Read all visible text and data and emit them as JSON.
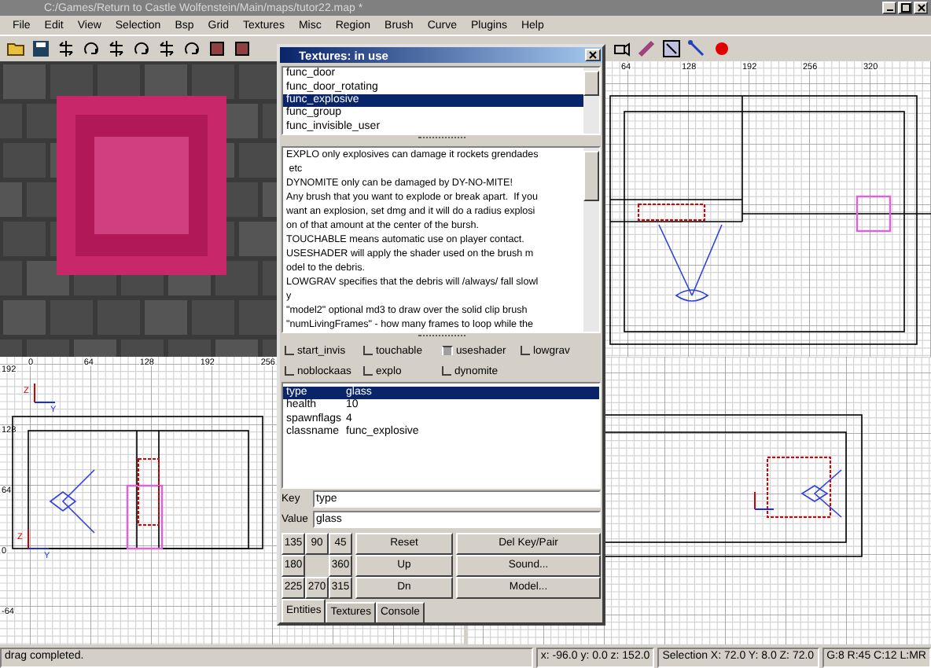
{
  "window": {
    "title": "C:/Games/Return to Castle Wolfenstein/Main/maps/tutor22.map *"
  },
  "menu_bar": [
    "File",
    "Edit",
    "View",
    "Selection",
    "Bsp",
    "Grid",
    "Textures",
    "Misc",
    "Region",
    "Brush",
    "Curve",
    "Plugins",
    "Help"
  ],
  "grid_views": [
    {
      "x_ticks": [
        "0",
        "64",
        "128",
        "192",
        "256"
      ],
      "y_ticks": [
        "192",
        "128",
        "64",
        "0",
        "-64"
      ],
      "axes": [
        {
          "vertical": "Z",
          "horizontal": "Y"
        },
        {
          "vertical": "Z",
          "horizontal": "Y"
        }
      ]
    },
    {
      "x_ticks": [
        "64",
        "128",
        "192",
        "256",
        "320"
      ]
    }
  ],
  "entity_window": {
    "title": "Textures: in use",
    "classes": [
      {
        "name": "func_door",
        "selected": false
      },
      {
        "name": "func_door_rotating",
        "selected": false
      },
      {
        "name": "func_explosive",
        "selected": true
      },
      {
        "name": "func_group",
        "selected": false
      },
      {
        "name": "func_invisible_user",
        "selected": false
      }
    ],
    "description": [
      "EXPLO only explosives can damage it rockets grendades",
      " etc",
      "DYNOMITE only can be damaged by DY-NO-MITE!",
      "Any brush that you want to explode or break apart.  If you",
      "want an explosion, set dmg and it will do a radius explosi",
      "on of that amount at the center of the bursh.",
      "TOUCHABLE means automatic use on player contact.",
      "USESHADER will apply the shader used on the brush m",
      "odel to the debris.",
      "LOWGRAV specifies that the debris will /always/ fall slowl",
      "y",
      "\"model2\" optional md3 to draw over the solid clip brush",
      "\"numLivingFrames\" - how many frames to loop while the"
    ],
    "spawnflags": [
      {
        "label": "start_invis",
        "checked": false
      },
      {
        "label": "touchable",
        "checked": false
      },
      {
        "label": "useshader",
        "checked": true
      },
      {
        "label": "lowgrav",
        "checked": false
      },
      {
        "label": "noblockaas",
        "checked": false
      },
      {
        "label": "explo",
        "checked": false
      },
      {
        "label": "dynomite",
        "checked": false
      }
    ],
    "keys": [
      {
        "key": "type",
        "value": "glass",
        "selected": true
      },
      {
        "key": "health",
        "value": "10",
        "selected": false
      },
      {
        "key": "spawnflags",
        "value": "4",
        "selected": false
      },
      {
        "key": "classname",
        "value": "func_explosive",
        "selected": false
      }
    ],
    "key_field": {
      "label": "Key",
      "value": "type"
    },
    "value_field": {
      "label": "Value",
      "value": "glass"
    },
    "angle_buttons": [
      "135",
      "90",
      "45",
      "180",
      "360",
      "225",
      "270",
      "315"
    ],
    "buttons": [
      "Reset",
      "Up",
      "Dn"
    ],
    "buttons_right": [
      "Del Key/Pair",
      "Sound...",
      "Model..."
    ],
    "tabs": [
      {
        "label": "Entities",
        "selected": true
      },
      {
        "label": "Textures",
        "selected": false
      },
      {
        "label": "Console",
        "selected": false
      }
    ]
  },
  "status_bar": {
    "message": "drag completed.",
    "cursor": "x: -96.0  y: 0.0  z: 152.0",
    "selection": "Selection X: 72.0  Y: 8.0  Z: 72.0",
    "grid": "G:8 R:45 C:12 L:MR"
  }
}
